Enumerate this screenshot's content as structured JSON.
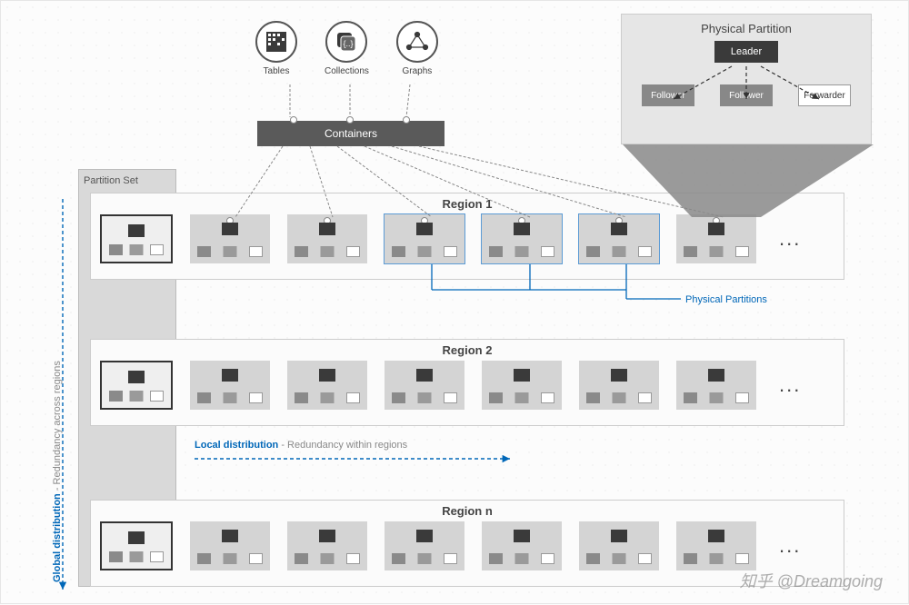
{
  "top": {
    "icons": [
      {
        "name": "tables-icon",
        "label": "Tables"
      },
      {
        "name": "collections-icon",
        "label": "Collections"
      },
      {
        "name": "graphs-icon",
        "label": "Graphs"
      }
    ],
    "containers_label": "Containers"
  },
  "physical_partition": {
    "title": "Physical Partition",
    "leader": "Leader",
    "followers": [
      "Follower",
      "Follower",
      "Forwarder"
    ]
  },
  "partition_set_label": "Partition Set",
  "regions": [
    {
      "title": "Region 1",
      "ellipsis": "..."
    },
    {
      "title": "Region 2",
      "ellipsis": "..."
    },
    {
      "title": "Region n",
      "ellipsis": "..."
    }
  ],
  "labels": {
    "global_bold": "Global distribution",
    "global_rest": " - Redundancy across regions",
    "local_bold": "Local distribution",
    "local_rest": " - Redundancy within regions",
    "physical_partitions": "Physical Partitions"
  },
  "watermark": "知乎 @Dreamgoing"
}
